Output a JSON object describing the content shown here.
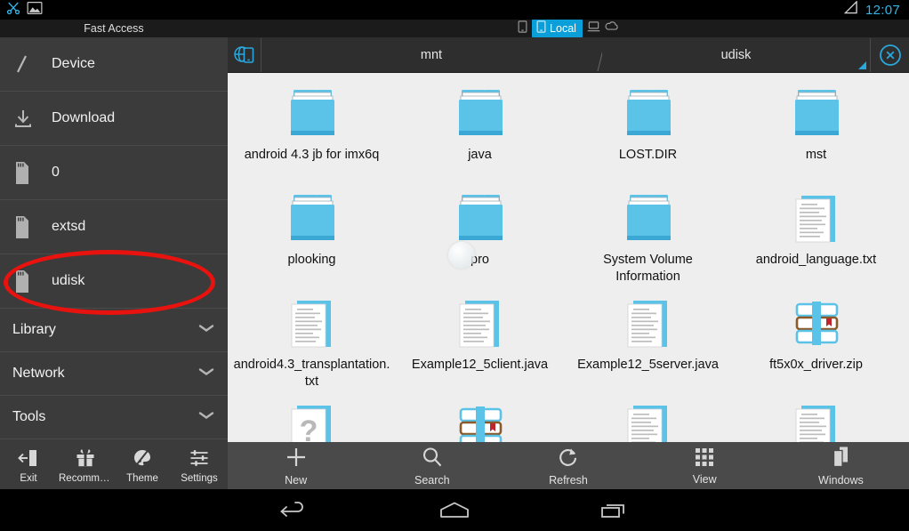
{
  "statusbar": {
    "icons": [
      "scissors-icon",
      "image-icon"
    ],
    "signal_icon": "signal-triangle-icon",
    "clock": "12:07"
  },
  "header": {
    "fast_access_label": "Fast Access",
    "tabs": [
      {
        "label": "",
        "icon": "phone-icon",
        "selected": false
      },
      {
        "label": "Local",
        "icon": "phone-icon",
        "selected": true
      },
      {
        "label": "",
        "icon": "computer-icon",
        "selected": false
      },
      {
        "label": "",
        "icon": "cloud-icon",
        "selected": false
      }
    ],
    "accent_color": "#0a9fd8"
  },
  "sidebar": {
    "items": [
      {
        "label": "Device",
        "icon": "slash-root-icon"
      },
      {
        "label": "Download",
        "icon": "download-icon"
      },
      {
        "label": "0",
        "icon": "sdcard-icon"
      },
      {
        "label": "extsd",
        "icon": "sdcard-icon"
      },
      {
        "label": "udisk",
        "icon": "sdcard-icon",
        "highlighted": true
      }
    ],
    "sections": [
      {
        "label": "Library",
        "icon": "chevron-down-icon"
      },
      {
        "label": "Network",
        "icon": "chevron-down-icon"
      },
      {
        "label": "Tools",
        "icon": "chevron-down-icon"
      }
    ],
    "bottom_items": [
      {
        "label": "Exit",
        "icon": "exit-icon"
      },
      {
        "label": "Recomme…",
        "icon": "gift-icon"
      },
      {
        "label": "Theme",
        "icon": "palette-icon"
      },
      {
        "label": "Settings",
        "icon": "sliders-icon"
      }
    ],
    "annotation_color": "#e8120e"
  },
  "breadcrumb": {
    "home_icon": "globe-device-icon",
    "crumbs": [
      "mnt",
      "udisk"
    ],
    "close_icon": "close-circle-icon"
  },
  "files": [
    {
      "name": "android 4.3 jb for imx6q",
      "type": "folder"
    },
    {
      "name": "java",
      "type": "folder"
    },
    {
      "name": "LOST.DIR",
      "type": "folder"
    },
    {
      "name": "mst",
      "type": "folder"
    },
    {
      "name": "plooking",
      "type": "folder"
    },
    {
      "name": "pro",
      "type": "folder"
    },
    {
      "name": "System Volume Information",
      "type": "folder"
    },
    {
      "name": "android_language.txt",
      "type": "text"
    },
    {
      "name": "android4.3_transplantation.txt",
      "type": "text"
    },
    {
      "name": "Example12_5client.java",
      "type": "text"
    },
    {
      "name": "Example12_5server.java",
      "type": "text"
    },
    {
      "name": "ft5x0x_driver.zip",
      "type": "zip"
    },
    {
      "name": "",
      "type": "unknown"
    },
    {
      "name": "",
      "type": "zip"
    },
    {
      "name": "",
      "type": "text"
    },
    {
      "name": "",
      "type": "text"
    }
  ],
  "toolbar": [
    {
      "label": "New",
      "icon": "plus-icon"
    },
    {
      "label": "Search",
      "icon": "search-icon"
    },
    {
      "label": "Refresh",
      "icon": "refresh-icon"
    },
    {
      "label": "View",
      "icon": "grid-icon"
    },
    {
      "label": "Windows",
      "icon": "windows-stack-icon"
    }
  ],
  "navbar": [
    {
      "icon": "back-icon"
    },
    {
      "icon": "home-icon"
    },
    {
      "icon": "recents-icon"
    }
  ],
  "colors": {
    "folder_blue": "#5bc2e8",
    "accent": "#33b5e5",
    "sidebar_bg": "#3b3b3b",
    "file_pane_bg": "#eeeeee"
  }
}
